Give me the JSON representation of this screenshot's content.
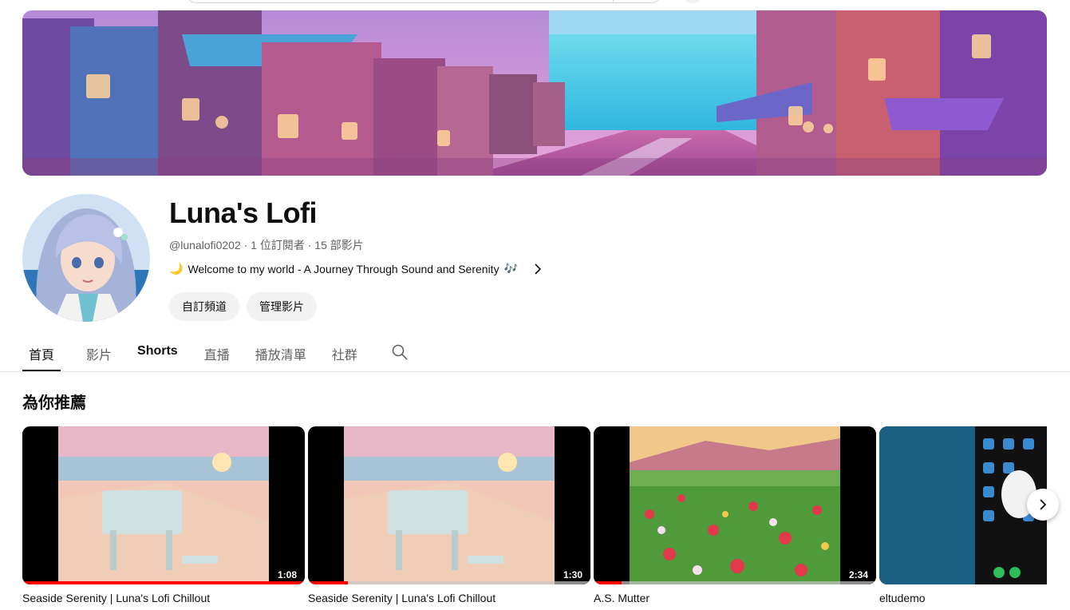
{
  "channel": {
    "name": "Luna's Lofi",
    "meta": "@lunalofi0202 · 1 位訂閱者 · 15 部影片",
    "description": "Welcome to my world - A Journey Through Sound and Serenity",
    "desc_prefix_glyph": "🌙",
    "desc_suffix_glyph": "🎶"
  },
  "buttons": {
    "customize": "自訂頻道",
    "manage": "管理影片"
  },
  "tabs": [
    {
      "label": "首頁",
      "active": true
    },
    {
      "label": "影片"
    },
    {
      "label": "Shorts"
    },
    {
      "label": "直播"
    },
    {
      "label": "播放清單"
    },
    {
      "label": "社群"
    }
  ],
  "section": {
    "title": "為你推薦"
  },
  "videos": [
    {
      "title": "Seaside Serenity | Luna's Lofi Chillout",
      "duration": "1:08",
      "progress": 1.0
    },
    {
      "title": "Seaside Serenity | Luna's Lofi Chillout",
      "duration": "1:30",
      "progress": 0.14
    },
    {
      "title": "A.S. Mutter",
      "duration": "2:34",
      "progress": 0.1
    },
    {
      "title": "eltudemo",
      "duration": "",
      "progress": 0
    }
  ],
  "colors": {
    "accent": "#ff0000",
    "pill_bg": "#f2f2f2",
    "text_secondary": "#606060"
  },
  "icons": {
    "tab_search": "search-icon",
    "shelf_next": "chevron-right-icon",
    "desc_more": "chevron-right-icon"
  }
}
